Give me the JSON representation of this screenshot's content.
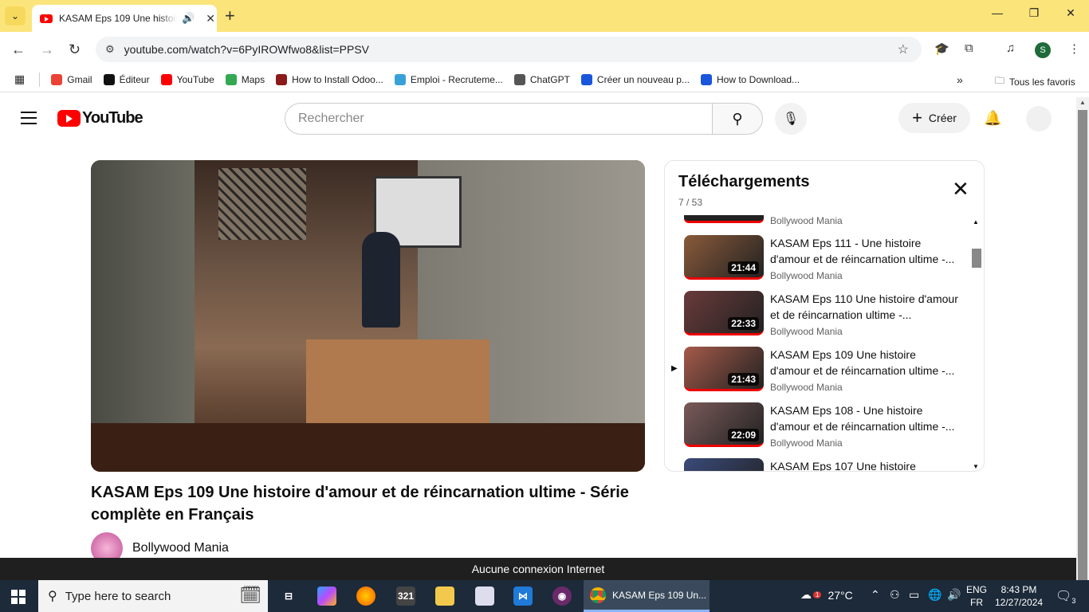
{
  "browser": {
    "tab_title": "KASAM Eps 109 Une histoire d'amour",
    "url": "youtube.com/watch?v=6PyIROWfwo8&list=PPSV",
    "profile_letter": "S",
    "bookmarks": [
      {
        "label": "Gmail",
        "color": "#ea4335"
      },
      {
        "label": "Éditeur",
        "color": "#111111"
      },
      {
        "label": "YouTube",
        "color": "#ff0000"
      },
      {
        "label": "Maps",
        "color": "#34a853"
      },
      {
        "label": "How to Install Odoo...",
        "color": "#8b1a1a"
      },
      {
        "label": "Emploi - Recruteme...",
        "color": "#3aa0d8"
      },
      {
        "label": "ChatGPT",
        "color": "#555555"
      },
      {
        "label": "Créer un nouveau p...",
        "color": "#1a56db"
      },
      {
        "label": "How to Download...",
        "color": "#1a56db"
      }
    ],
    "all_bookmarks_label": "Tous les favoris"
  },
  "youtube": {
    "logo_text": "YouTube",
    "search_placeholder": "Rechercher",
    "create_label": "Créer",
    "video_title": "KASAM Eps 109 Une histoire d'amour et de réincarnation ultime - Série complète en Français",
    "channel_name": "Bollywood Mania",
    "playlist": {
      "title": "Téléchargements",
      "position": "7 / 53",
      "partial_top_channel": "Bollywood Mania",
      "items": [
        {
          "title": "KASAM Eps 111 - Une histoire d'amour et de réincarnation ultime -...",
          "channel": "Bollywood Mania",
          "duration": "21:44",
          "playing": false,
          "color": "#8a5a3a"
        },
        {
          "title": "KASAM Eps 110 Une histoire d'amour et de réincarnation ultime -...",
          "channel": "Bollywood Mania",
          "duration": "22:33",
          "playing": false,
          "color": "#6a3a3a"
        },
        {
          "title": "KASAM Eps 109 Une histoire d'amour et de réincarnation ultime -...",
          "channel": "Bollywood Mania",
          "duration": "21:43",
          "playing": true,
          "color": "#a55a4a"
        },
        {
          "title": "KASAM Eps 108 - Une histoire d'amour et de réincarnation ultime -...",
          "channel": "Bollywood Mania",
          "duration": "22:09",
          "playing": false,
          "color": "#7a5a5a"
        },
        {
          "title": "KASAM Eps 107 Une histoire",
          "channel": "",
          "duration": "",
          "playing": false,
          "color": "#3a4a7a"
        }
      ]
    }
  },
  "offline_message": "Aucune connexion Internet",
  "taskbar": {
    "search_placeholder": "Type here to search",
    "active_window": "KASAM Eps 109 Un...",
    "weather": "27°C",
    "lang_top": "ENG",
    "lang_bottom": "FR",
    "time": "8:43 PM",
    "date": "12/27/2024",
    "notification_count": "3",
    "weather_badge": "1"
  }
}
